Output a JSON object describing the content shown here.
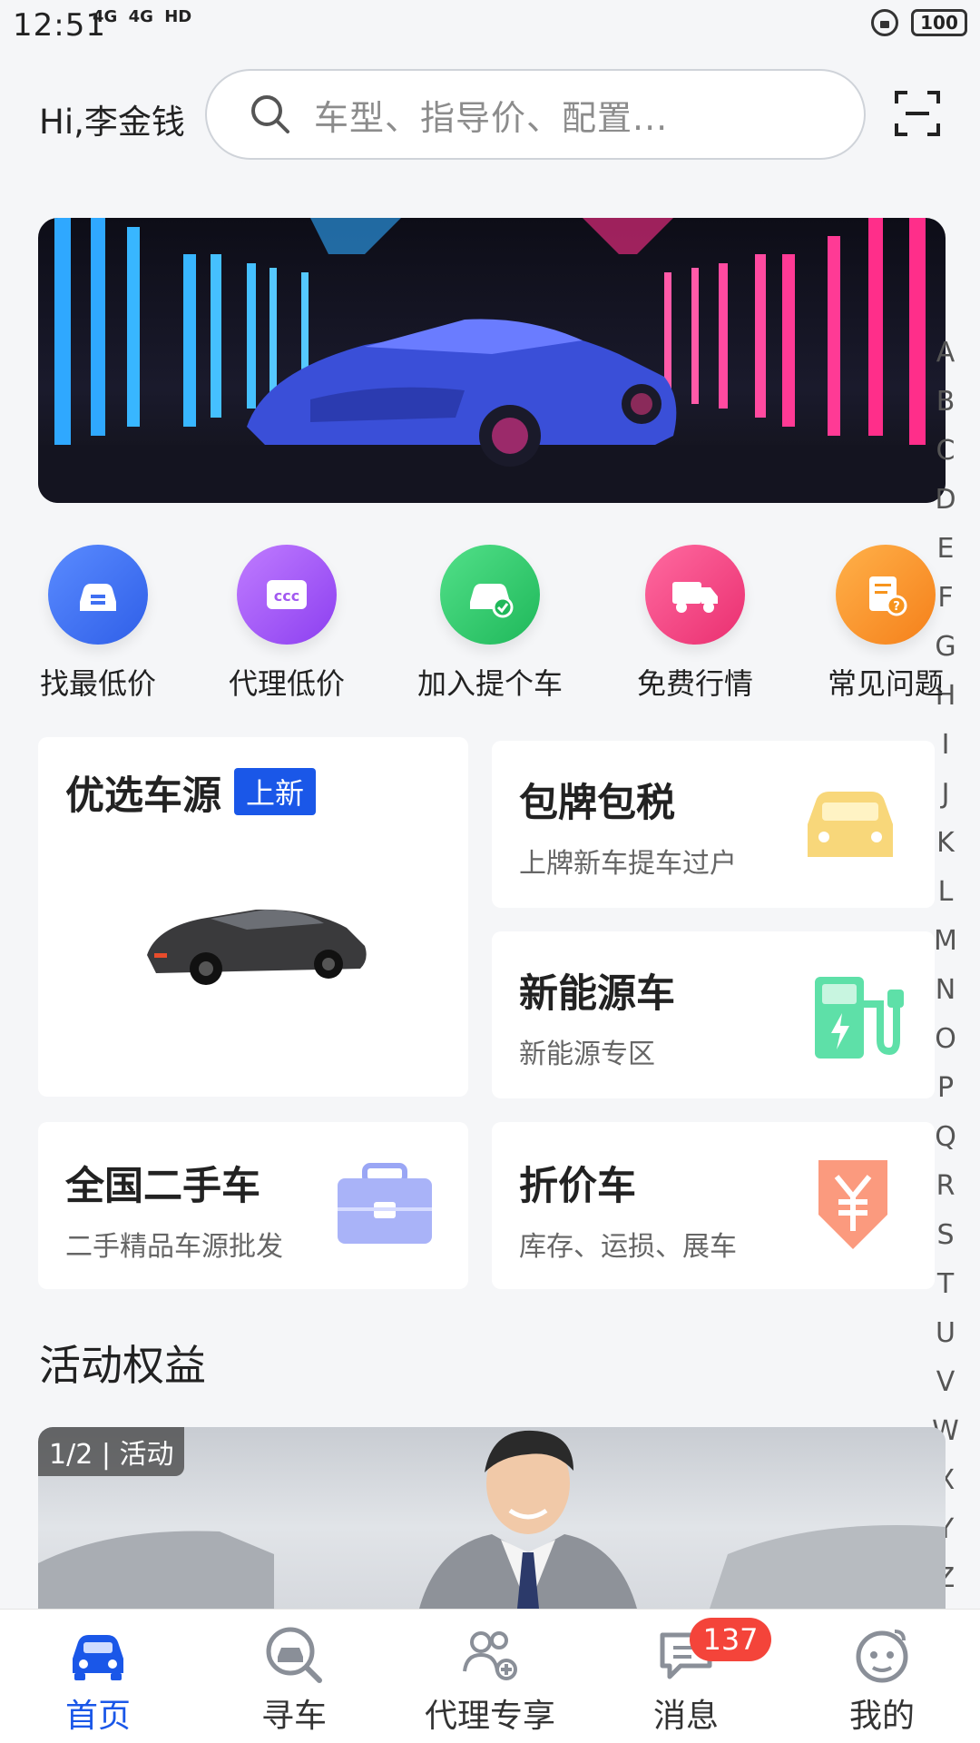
{
  "status_bar": {
    "time": "12:51",
    "network": [
      "4G",
      "4G",
      "HD"
    ],
    "battery": "100"
  },
  "header": {
    "greeting": "Hi,李金钱",
    "search_placeholder": "车型、指导价、配置..."
  },
  "quick_menu": [
    {
      "label": "找最低价",
      "icon": "car-tag-icon",
      "color": "#3f6ff2"
    },
    {
      "label": "代理低价",
      "icon": "ccc-icon",
      "color": "#a259f0"
    },
    {
      "label": "加入提个车",
      "icon": "car-check-icon",
      "color": "#2cc96a"
    },
    {
      "label": "免费行情",
      "icon": "truck-icon",
      "color": "#f0457d"
    },
    {
      "label": "常见问题",
      "icon": "question-doc-icon",
      "color": "#f7941d"
    }
  ],
  "cards": {
    "featured": {
      "title": "优选车源",
      "badge": "上新"
    },
    "plate": {
      "title": "包牌包税",
      "subtitle": "上牌新车提车过户"
    },
    "ev": {
      "title": "新能源车",
      "subtitle": "新能源专区"
    },
    "used": {
      "title": "全国二手车",
      "subtitle": "二手精品车源批发"
    },
    "discount": {
      "title": "折价车",
      "subtitle": "库存、运损、展车"
    }
  },
  "alpha_index": [
    "A",
    "B",
    "C",
    "D",
    "E",
    "F",
    "G",
    "H",
    "I",
    "J",
    "K",
    "L",
    "M",
    "N",
    "O",
    "P",
    "Q",
    "R",
    "S",
    "T",
    "U",
    "V",
    "W",
    "X",
    "Y",
    "Z"
  ],
  "activity": {
    "section_title": "活动权益",
    "tag": "1/2 | 活动"
  },
  "bottom_nav": [
    {
      "label": "首页",
      "icon": "car-front-icon",
      "active": true
    },
    {
      "label": "寻车",
      "icon": "car-search-icon",
      "active": false
    },
    {
      "label": "代理专享",
      "icon": "agent-people-icon",
      "active": false
    },
    {
      "label": "消息",
      "icon": "message-icon",
      "active": false
    },
    {
      "label": "我的",
      "icon": "profile-face-icon",
      "active": false
    }
  ],
  "message_badge": "137",
  "colors": {
    "accent": "#1a57e8",
    "badge_red": "#f4443a",
    "background": "#f5f6f8"
  }
}
